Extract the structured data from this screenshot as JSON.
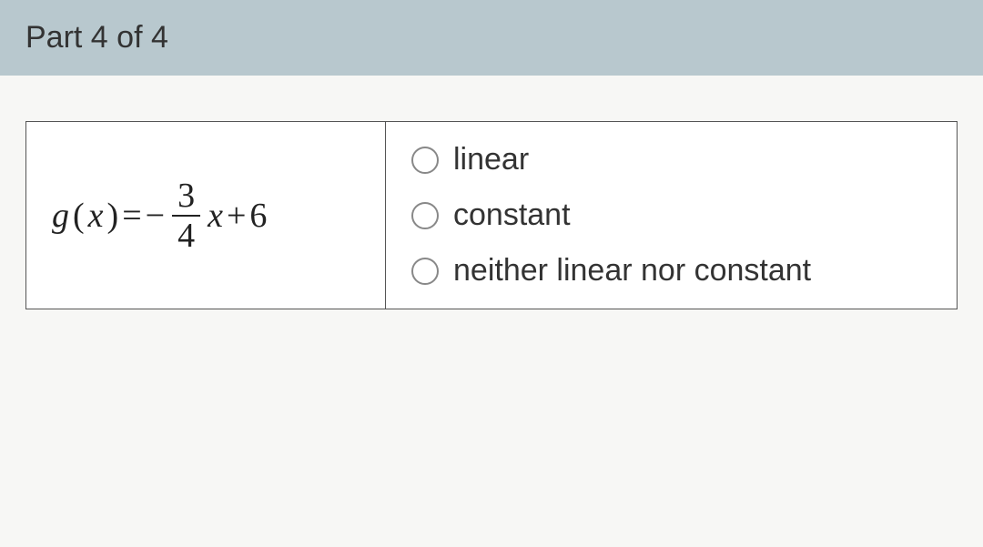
{
  "header": {
    "title": "Part 4 of 4"
  },
  "question": {
    "equation": {
      "func": "g",
      "var": "x",
      "eq": "=",
      "neg": "−",
      "frac_num": "3",
      "frac_den": "4",
      "var2": "x",
      "plus": "+",
      "const": "6"
    }
  },
  "options": [
    {
      "label": "linear"
    },
    {
      "label": "constant"
    },
    {
      "label": "neither linear nor constant"
    }
  ]
}
